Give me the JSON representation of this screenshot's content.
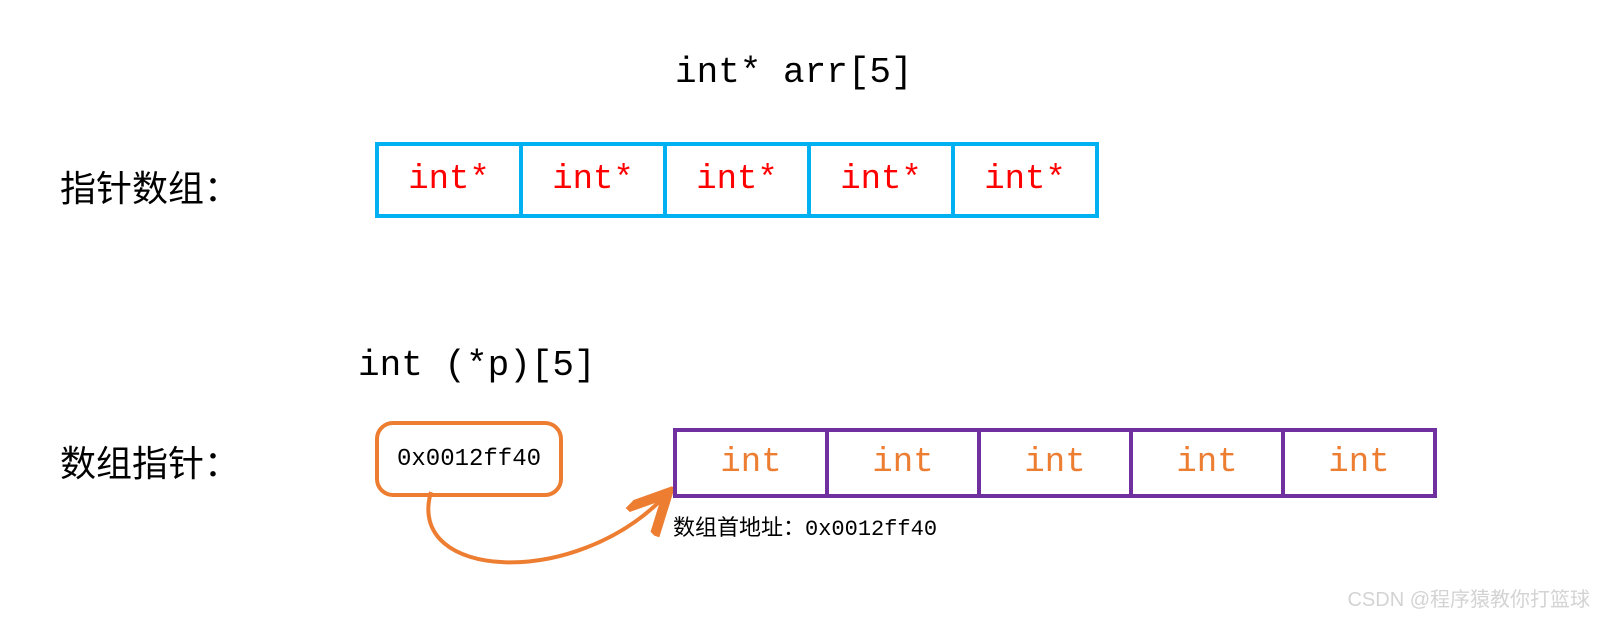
{
  "titles": {
    "top_declaration": "int* arr[5]",
    "mid_declaration": "int (*p)[5]"
  },
  "labels": {
    "pointer_array": "指针数组：",
    "array_pointer": "数组指针："
  },
  "blue_cells": [
    "int*",
    "int*",
    "int*",
    "int*",
    "int*"
  ],
  "purple_cells": [
    "int",
    "int",
    "int",
    "int",
    "int"
  ],
  "address_box": "0x0012ff40",
  "caption_prefix": "数组首地址：",
  "caption_value": "0x0012ff40",
  "watermark": "CSDN @程序猿教你打篮球",
  "colors": {
    "blue": "#00b0f0",
    "red": "#ff0000",
    "orange": "#ed7d31",
    "purple": "#7030a0"
  }
}
